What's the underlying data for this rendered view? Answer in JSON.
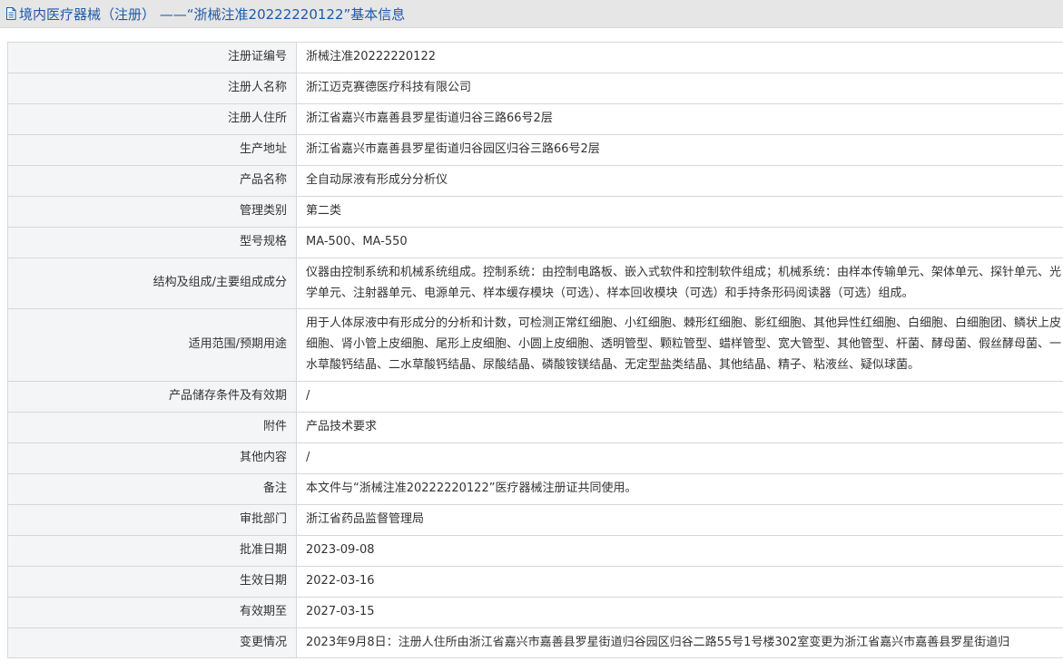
{
  "header": {
    "title": "境内医疗器械（注册） ——“浙械注准20222220122”基本信息"
  },
  "rows": [
    {
      "label": "注册证编号",
      "value": "浙械注准20222220122"
    },
    {
      "label": "注册人名称",
      "value": "浙江迈克赛德医疗科技有限公司"
    },
    {
      "label": "注册人住所",
      "value": "浙江省嘉兴市嘉善县罗星街道归谷三路66号2层"
    },
    {
      "label": "生产地址",
      "value": "浙江省嘉兴市嘉善县罗星街道归谷园区归谷三路66号2层"
    },
    {
      "label": "产品名称",
      "value": "全自动尿液有形成分分析仪"
    },
    {
      "label": "管理类别",
      "value": "第二类"
    },
    {
      "label": "型号规格",
      "value": "MA-500、MA-550"
    },
    {
      "label": "结构及组成/主要组成成分",
      "value": "仪器由控制系统和机械系统组成。控制系统：由控制电路板、嵌入式软件和控制软件组成；机械系统：由样本传输单元、架体单元、探针单元、光学单元、注射器单元、电源单元、样本缓存模块（可选）、样本回收模块（可选）和手持条形码阅读器（可选）组成。"
    },
    {
      "label": "适用范围/预期用途",
      "value": "用于人体尿液中有形成分的分析和计数，可检测正常红细胞、小红细胞、棘形红细胞、影红细胞、其他异性红细胞、白细胞、白细胞团、鳞状上皮细胞、肾小管上皮细胞、尾形上皮细胞、小圆上皮细胞、透明管型、颗粒管型、蜡样管型、宽大管型、其他管型、杆菌、酵母菌、假丝酵母菌、一水草酸钙结晶、二水草酸钙结晶、尿酸结晶、磷酸铵镁结晶、无定型盐类结晶、其他结晶、精子、粘液丝、疑似球菌。"
    },
    {
      "label": "产品储存条件及有效期",
      "value": "/"
    },
    {
      "label": "附件",
      "value": "产品技术要求"
    },
    {
      "label": "其他内容",
      "value": "/"
    },
    {
      "label": "备注",
      "value": "本文件与“浙械注准20222220122”医疗器械注册证共同使用。"
    },
    {
      "label": "审批部门",
      "value": "浙江省药品监督管理局"
    },
    {
      "label": "批准日期",
      "value": "2023-09-08"
    },
    {
      "label": "生效日期",
      "value": "2022-03-16"
    },
    {
      "label": "有效期至",
      "value": "2027-03-15"
    },
    {
      "label": "变更情况",
      "value": "2023年9月8日：注册人住所由浙江省嘉兴市嘉善县罗星街道归谷园区归谷二路55号1号楼302室变更为浙江省嘉兴市嘉善县罗星街道归"
    }
  ]
}
